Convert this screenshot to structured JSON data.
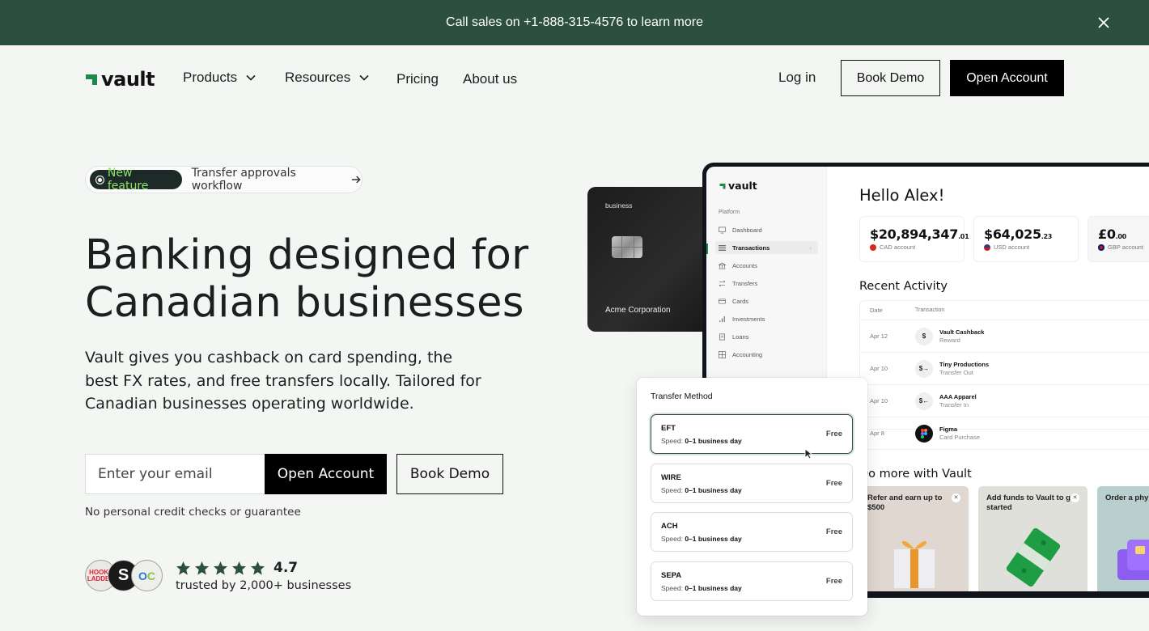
{
  "announcement": {
    "text": "Call sales on +1-888-315-4576 to learn more",
    "close_icon": "close-icon"
  },
  "nav": {
    "brand": "vault",
    "items": [
      {
        "label": "Products",
        "has_dropdown": true
      },
      {
        "label": "Resources",
        "has_dropdown": true
      },
      {
        "label": "Pricing",
        "has_dropdown": false
      },
      {
        "label": "About us",
        "has_dropdown": false
      }
    ],
    "login": "Log in",
    "book_demo": "Book Demo",
    "open_account": "Open Account"
  },
  "hero": {
    "badge": "New feature",
    "announcement_link": "Transfer approvals workflow",
    "headline_line1": "Banking designed for",
    "headline_line2": "Canadian businesses",
    "subtext": "Vault gives you cashback on card spending, the best FX rates, and free transfers locally. Tailored for Canadian businesses operating worldwide.",
    "email_placeholder": "Enter your email",
    "email_value": "",
    "open_account": "Open Account",
    "book_demo": "Book Demo",
    "disclaimer": "No personal credit checks or guarantee",
    "logos": [
      "HOOK+ LADDER",
      "S",
      "OC"
    ],
    "rating": "4.7",
    "stars": 5,
    "trusted": "trusted by 2,000+ businesses"
  },
  "card": {
    "label": "business",
    "holder": "Acme Corporation"
  },
  "app": {
    "brand": "vault",
    "section": "Platform",
    "sidebar": [
      {
        "label": "Dashboard",
        "icon": "monitor-icon",
        "active": false
      },
      {
        "label": "Transactions",
        "icon": "list-icon",
        "active": true
      },
      {
        "label": "Accounts",
        "icon": "bank-icon",
        "active": false
      },
      {
        "label": "Transfers",
        "icon": "arrows-icon",
        "active": false
      },
      {
        "label": "Cards",
        "icon": "card-icon",
        "active": false
      },
      {
        "label": "Investments",
        "icon": "bar-chart-icon",
        "active": false
      },
      {
        "label": "Loans",
        "icon": "scroll-icon",
        "active": false
      },
      {
        "label": "Accounting",
        "icon": "grid-icon",
        "active": false
      }
    ],
    "greeting": "Hello Alex!",
    "accounts": [
      {
        "amount": "$20,894,347",
        "cents": ".01",
        "label": "CAD account",
        "flag_color": "#d52b1e"
      },
      {
        "amount": "$64,025",
        "cents": ".23",
        "label": "USD account",
        "flag_color": "#3c3b6e"
      },
      {
        "amount": "£0",
        "cents": ".00",
        "label": "GBP account",
        "flag_color": "#c8102e"
      }
    ],
    "recent_title": "Recent Activity",
    "table_headers": [
      "Date",
      "Transaction"
    ],
    "transactions": [
      {
        "date": "Apr 12",
        "icon": "$",
        "name": "Vault Cashback",
        "type": "Reward"
      },
      {
        "date": "Apr 10",
        "icon": "$→",
        "name": "Tiny Productions",
        "type": "Transfer Out"
      },
      {
        "date": "Apr 10",
        "icon": "$←",
        "name": "AAA Apparel",
        "type": "Transfer In"
      },
      {
        "date": "Apr 8",
        "icon": "figma",
        "name": "Figma",
        "type": "Card Purchase"
      }
    ],
    "do_more_title": "Do more with Vault",
    "promos": [
      {
        "text": "Refer and earn up to $500",
        "bg": "#e0d8d0",
        "art": "gift-icon",
        "dismissible": true
      },
      {
        "text": "Add funds to Vault to get started",
        "bg": "#dfe0d9",
        "art": "cash-stack-icon",
        "dismissible": true
      },
      {
        "text": "Order a physical card",
        "bg": "#b9cfcd",
        "art": "purple-card-icon",
        "dismissible": false
      }
    ]
  },
  "transfer_method": {
    "title": "Transfer Method",
    "options": [
      {
        "name": "EFT",
        "speed_label": "Speed:",
        "speed": "0–1 business day",
        "fee": "Free",
        "selected": true
      },
      {
        "name": "WIRE",
        "speed_label": "Speed:",
        "speed": "0–1 business day",
        "fee": "Free",
        "selected": false
      },
      {
        "name": "ACH",
        "speed_label": "Speed:",
        "speed": "0–1 business day",
        "fee": "Free",
        "selected": false
      },
      {
        "name": "SEPA",
        "speed_label": "Speed:",
        "speed": "0–1 business day",
        "fee": "Free",
        "selected": false
      }
    ]
  },
  "colors": {
    "announcement_bg": "#2d4f40",
    "page_bg": "#f4f6f4",
    "brand_green": "#1e8a4a",
    "badge_text": "#8ee26a",
    "star": "#2d4f40"
  }
}
